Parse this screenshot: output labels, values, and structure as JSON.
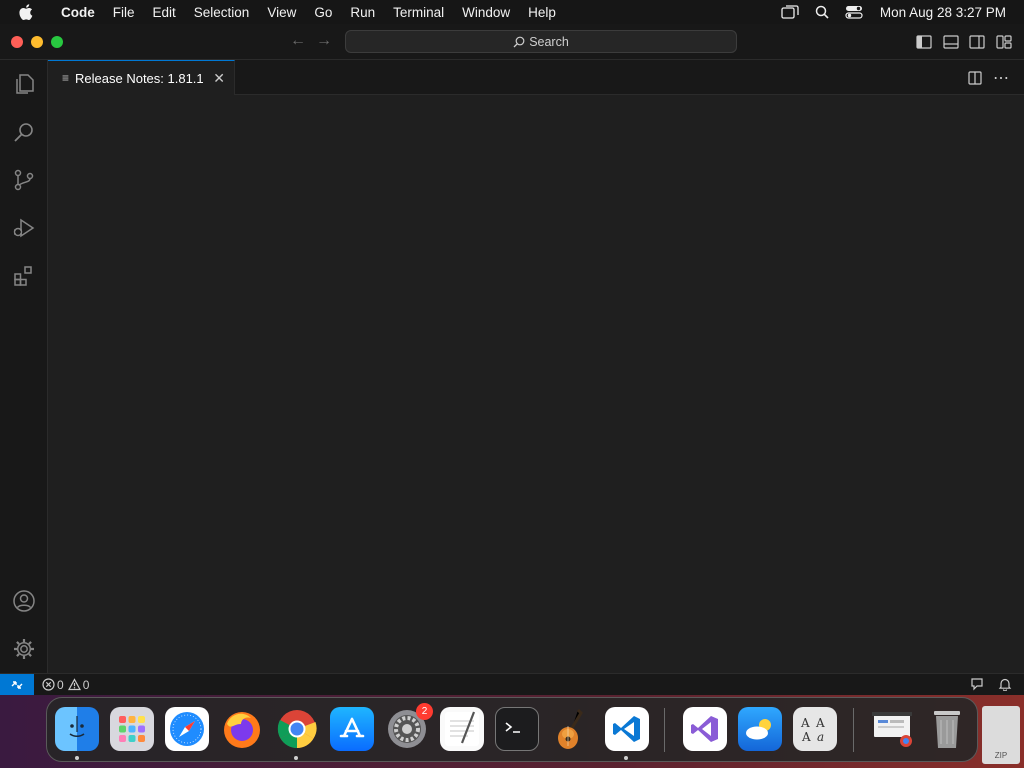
{
  "menubar": {
    "app_name": "Code",
    "items": [
      "File",
      "Edit",
      "Selection",
      "View",
      "Go",
      "Run",
      "Terminal",
      "Window",
      "Help"
    ],
    "clock": "Mon Aug 28  3:27 PM"
  },
  "titlebar": {
    "search_label": "Search"
  },
  "tab": {
    "title": "Release Notes: 1.81.1"
  },
  "statusbar": {
    "errors": "0",
    "warnings": "0"
  },
  "dock": {
    "settings_badge": "2",
    "zip_label": "ZIP"
  },
  "colors": {
    "accent": "#0078d4",
    "editor_bg": "#1f1f1f",
    "chrome_bg": "#181818"
  }
}
